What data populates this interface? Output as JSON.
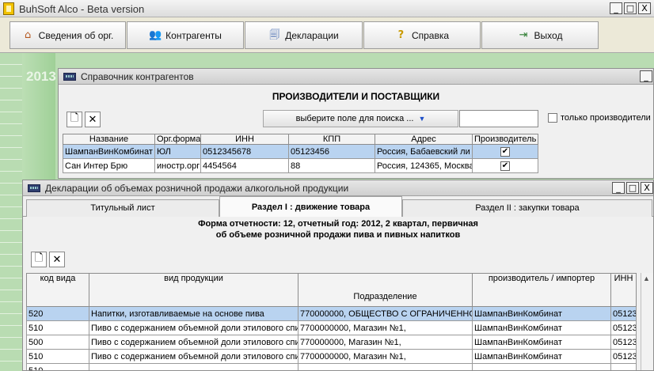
{
  "main_window": {
    "title": "BuhSoft Alco - Beta version",
    "controls": {
      "minimize": "_",
      "maximize": "□",
      "close": "X"
    }
  },
  "toolbar": {
    "buttons": [
      {
        "label": "Сведения об орг.",
        "icon": "home-icon"
      },
      {
        "label": "Контрагенты",
        "icon": "users-icon"
      },
      {
        "label": "Декларации",
        "icon": "documents-icon"
      },
      {
        "label": "Справка",
        "icon": "help-icon"
      },
      {
        "label": "Выход",
        "icon": "exit-icon"
      }
    ]
  },
  "desktop": {
    "year": "2013"
  },
  "counterparts": {
    "title": "Справочник контрагентов",
    "heading": "ПРОИЗВОДИТЕЛИ И ПОСТАВЩИКИ",
    "add_label": "🗋",
    "delete_label": "✕",
    "search_field_button": "выберите поле для поиска ...",
    "search_value": "",
    "only_producers_label": "только производители",
    "columns": [
      "Название",
      "Орг.форма",
      "ИНН",
      "КПП",
      "Адрес",
      "Производитель"
    ],
    "rows": [
      {
        "name": "ШампанВинКомбинат",
        "form": "ЮЛ",
        "inn": "0512345678",
        "kpp": "05123456",
        "address": "Россия, Бабаевский ли",
        "producer": "✔"
      },
      {
        "name": "Сан Интер Брю",
        "form": "иностр.орг",
        "inn": "4454564",
        "kpp": "88",
        "address": "Россия, 124365, Москва",
        "producer": "✔"
      }
    ]
  },
  "declarations": {
    "title": "Декларации об объемах розничной продажи алкогольной продукции",
    "tabs": [
      "Титульный лист",
      "Раздел I : движение товара",
      "Раздел II : закупки товара"
    ],
    "form_title_line1": "Форма отчетности: 12, отчетный год: 2012, 2 квартал, первичная",
    "form_title_line2": "об объеме розничной продажи пива и пивных напитков",
    "add_label": "🗋",
    "delete_label": "✕",
    "columns": [
      "код вида",
      "вид продукции",
      "Подразделение",
      "производитель / импортер",
      "ИНН"
    ],
    "rows": [
      {
        "code": "520",
        "product": "Напитки, изготавливаемые на основе пива",
        "division": "770000000, ОБЩЕСТВО С ОГРАНИЧЕННОЙ",
        "producer": "ШампанВинКомбинат",
        "inn": "05123"
      },
      {
        "code": "510",
        "product": "Пиво с содержанием объемной доли этилового спи",
        "division": "7700000000, Магазин №1,",
        "producer": "ШампанВинКомбинат",
        "inn": "05123"
      },
      {
        "code": "500",
        "product": "Пиво с содержанием объемной доли этилового спи",
        "division": "770000000, Магазин №1,",
        "producer": "ШампанВинКомбинат",
        "inn": "05123"
      },
      {
        "code": "510",
        "product": "Пиво с содержанием объемной доли этилового спи",
        "division": "7700000000, Магазин №1,",
        "producer": "ШампанВинКомбинат",
        "inn": "05123"
      },
      {
        "code": "510",
        "product": "",
        "division": "",
        "producer": "",
        "inn": ""
      }
    ]
  },
  "colors": {
    "selection": "#b9d3f0",
    "desktop": "#b9dcb2",
    "accent": "#1d4fc8"
  }
}
